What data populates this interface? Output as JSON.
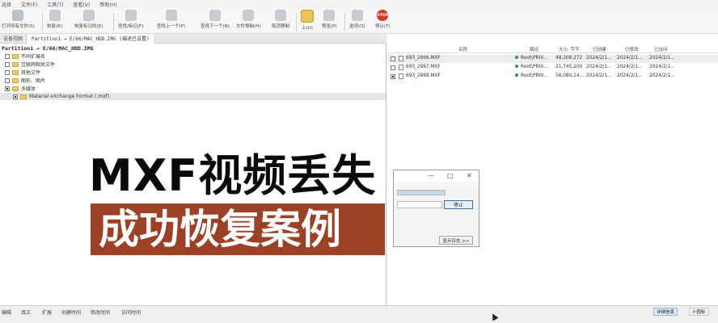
{
  "menubar": {
    "items": [
      "选择",
      "文件(F)",
      "工具(T)",
      "查看(V)",
      "帮助(H)"
    ]
  },
  "toolbar": {
    "buttons": [
      {
        "label": "打开所有文件(S)"
      },
      {
        "label": "恢复(R)"
      },
      {
        "label": "恢复标记的(E)"
      },
      {
        "label": "查找/标记(F)"
      },
      {
        "label": "查找上一个(P)"
      },
      {
        "label": "查找下一个(N)"
      },
      {
        "label": "文件预制(H)"
      },
      {
        "label": "取消预制"
      },
      {
        "label": "上(U)"
      },
      {
        "label": "预览(P)"
      },
      {
        "label": "选项(O)"
      },
      {
        "label": "停止(T)"
      }
    ],
    "stop_icon_text": "STOP"
  },
  "tabs": {
    "tab1": "设备视图",
    "tab2": "Partition1 → E/66/MAC_HDD.IMG (描述已设置)"
  },
  "tree": {
    "root": "Partition1 → E/66/MAC_HDD.IMG",
    "items": [
      "不同扩展名",
      "互联网相关文件",
      "其他文件",
      "图形、图片",
      "多媒体",
      "Material eXchange Format (.mxf)"
    ]
  },
  "filelist": {
    "columns": [
      "名称",
      "路径",
      "大小, 字节",
      "已创建",
      "已修改",
      "已访问"
    ],
    "rows": [
      {
        "name": "693_2866.MXF",
        "path": "Root\\PRIV...",
        "size": "48,308,272",
        "created": "2024/2/1...",
        "modified": "2024/2/1...",
        "accessed": "2024/2/1..."
      },
      {
        "name": "693_2867.MXF",
        "path": "Root\\PRIV...",
        "size": "21,745,200",
        "created": "2024/2/1...",
        "modified": "2024/2/1...",
        "accessed": "2024/2/1..."
      },
      {
        "name": "693_2868.MXF",
        "path": "Root\\PRIV...",
        "size": "56,080,14...",
        "created": "2024/2/1...",
        "modified": "2024/2/1...",
        "accessed": "2024/2/1..."
      }
    ]
  },
  "dialog": {
    "min": "—",
    "max": "□",
    "close": "✕",
    "stop_label": "停止",
    "log_label": "显示日志 >>"
  },
  "statusbar": {
    "left_items": [
      "编辑",
      "真正",
      "扩展",
      "创建时间",
      "修改时间",
      "访问时间"
    ],
    "view_detail": "详细信息",
    "view_small": "小图标"
  },
  "overlay": {
    "headline1": "MXF视频丢失",
    "headline2": "成功恢复案例"
  },
  "colors": {
    "accent": "#9c4126",
    "status_dot": "#1e9e4a",
    "stop_red": "#d9342b"
  }
}
